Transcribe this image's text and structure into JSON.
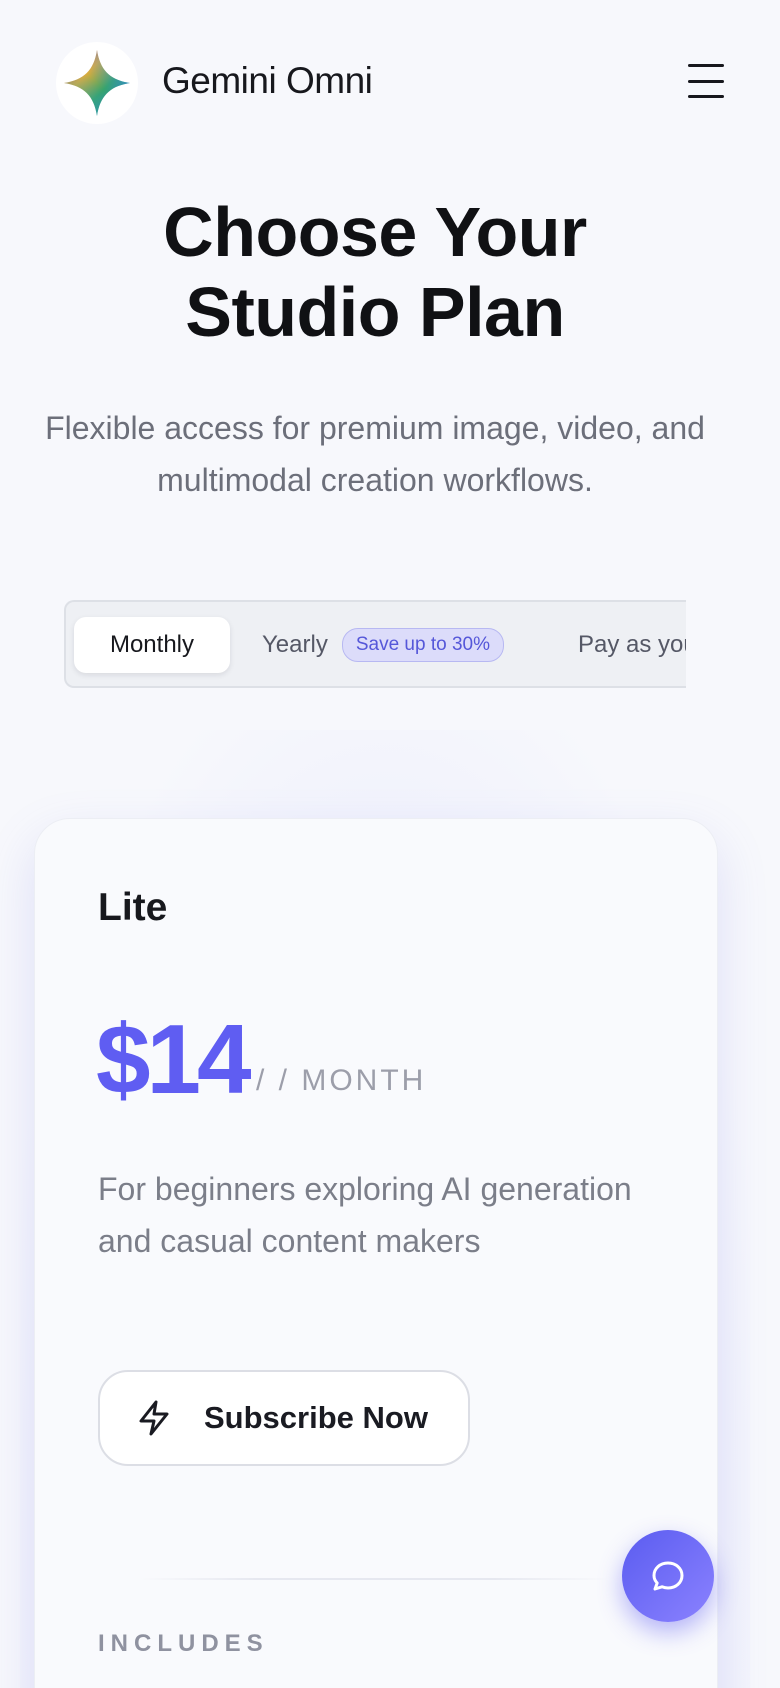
{
  "header": {
    "brand": "Gemini Omni",
    "logo_icon": "sparkle-logo-icon",
    "menu_icon": "hamburger-menu-icon"
  },
  "hero": {
    "title_line1": "Choose Your",
    "title_line2": "Studio Plan",
    "subtitle_line1": "Flexible access for premium image, video, and",
    "subtitle_line2": "multimodal creation workflows."
  },
  "billing": {
    "options": [
      {
        "label": "Monthly",
        "selected": true
      },
      {
        "label": "Yearly",
        "badge": "Save up to 30%",
        "selected": false
      },
      {
        "label": "Pay as you",
        "selected": false
      }
    ]
  },
  "plan": {
    "name": "Lite",
    "price": "$14",
    "period": "/ / MONTH",
    "description_line1": "For beginners exploring AI generation",
    "description_line2": "and casual content makers",
    "cta_label": "Subscribe Now",
    "cta_icon": "lightning-bolt-icon",
    "includes_heading": "INCLUDES"
  },
  "chat": {
    "icon": "chat-bubble-icon"
  },
  "colors": {
    "accent": "#5f5df2",
    "badge_bg": "#dcdcfa",
    "background": "#f7f8fc"
  }
}
